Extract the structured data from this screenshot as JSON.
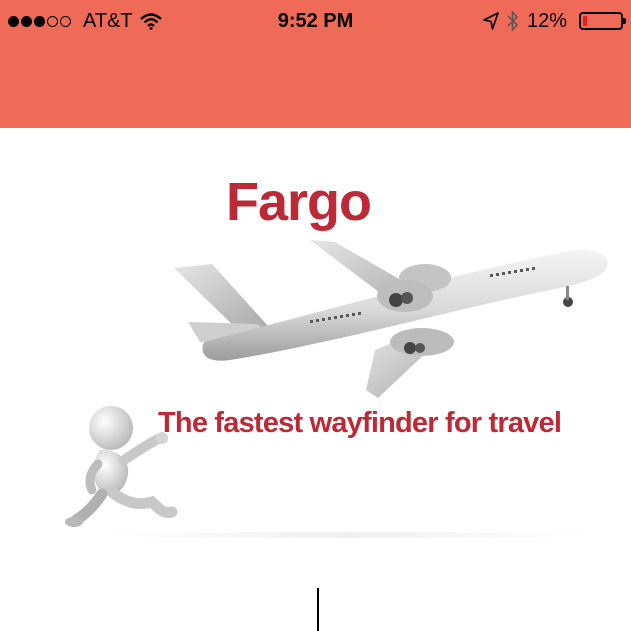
{
  "status_bar": {
    "signal_dots_filled": 3,
    "signal_dots_total": 5,
    "carrier": "AT&T",
    "time": "9:52 PM",
    "battery_percent_label": "12%",
    "battery_level": 0.12
  },
  "splash": {
    "app_name": "Fargo",
    "tagline": "The fastest wayfinder for travel"
  },
  "colors": {
    "header_bg": "#ef6a57",
    "brand_red": "#bd2a37",
    "battery_low": "#e0221b"
  }
}
